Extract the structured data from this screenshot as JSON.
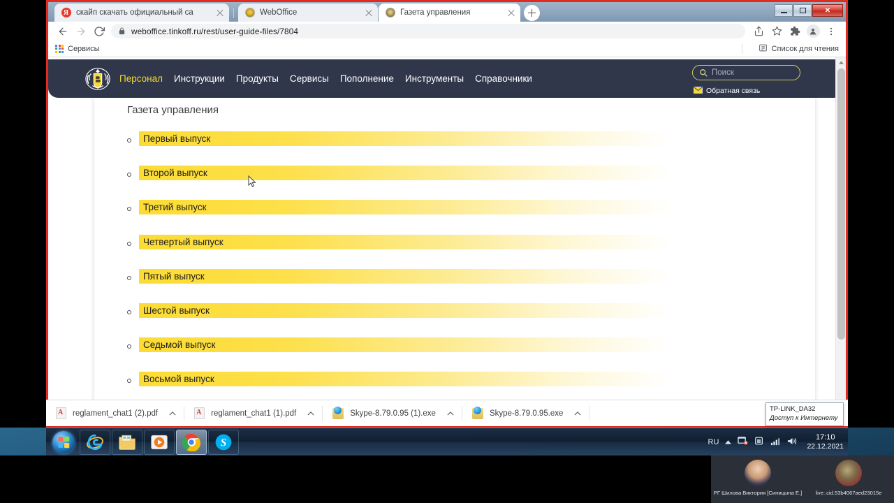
{
  "browser": {
    "tabs": [
      {
        "title": "скайп скачать официальный са",
        "favicon": "yandex-icon",
        "active": false
      },
      {
        "title": "WebOffice",
        "favicon": "crest-icon",
        "active": false
      },
      {
        "title": "Газета управления",
        "favicon": "crest-icon",
        "active": true
      }
    ],
    "new_tab_label": "+",
    "window_controls": {
      "minimize": "minimize-icon",
      "maximize": "maximize-icon",
      "close": "✕"
    },
    "toolbar": {
      "back": "back-arrow-icon",
      "forward": "forward-arrow-icon",
      "reload": "reload-icon",
      "lock": "lock-icon",
      "url": "weboffice.tinkoff.ru/rest/user-guide-files/7804",
      "share": "share-icon",
      "bookmark": "star-icon",
      "extensions": "puzzle-icon",
      "profile": "avatar-icon",
      "menu": "three-dot-menu-icon"
    },
    "bookmarks": {
      "apps_label": "Сервисы",
      "reading_list_label": "Список для чтения"
    }
  },
  "site": {
    "nav": {
      "logo": "tinkoff-crest-icon",
      "links": [
        {
          "label": "Персонал",
          "active": true
        },
        {
          "label": "Инструкции",
          "active": false
        },
        {
          "label": "Продукты",
          "active": false
        },
        {
          "label": "Сервисы",
          "active": false
        },
        {
          "label": "Пополнение",
          "active": false
        },
        {
          "label": "Инструменты",
          "active": false
        },
        {
          "label": "Справочники",
          "active": false
        }
      ],
      "search_placeholder": "Поиск",
      "feedback_label": "Обратная связь",
      "accent_color": "#f3d832",
      "bar_color": "#30374b"
    },
    "page_title": "Газета управления",
    "issues": [
      {
        "label": "Первый выпуск"
      },
      {
        "label": "Второй выпуск"
      },
      {
        "label": "Третий выпуск"
      },
      {
        "label": "Четвертый выпуск"
      },
      {
        "label": "Пятый выпуск"
      },
      {
        "label": "Шестой выпуск"
      },
      {
        "label": "Седьмой выпуск"
      },
      {
        "label": "Восьмой выпуск"
      }
    ],
    "highlight_color": "#fcdc33"
  },
  "downloads": [
    {
      "name": "reglament_chat1 (2).pdf",
      "type": "pdf"
    },
    {
      "name": "reglament_chat1 (1).pdf",
      "type": "pdf"
    },
    {
      "name": "Skype-8.79.0.95 (1).exe",
      "type": "exe"
    },
    {
      "name": "Skype-8.79.0.95.exe",
      "type": "exe"
    }
  ],
  "tray_tooltip": {
    "network_name": "TP-LINK_DA32",
    "status": "Доступ к Интернету"
  },
  "taskbar": {
    "start": "windows-start-icon",
    "apps": [
      {
        "name": "internet-explorer-icon",
        "active": false
      },
      {
        "name": "file-explorer-icon",
        "active": false
      },
      {
        "name": "media-player-icon",
        "active": false
      },
      {
        "name": "google-chrome-icon",
        "active": true
      },
      {
        "name": "skype-icon",
        "active": false
      }
    ],
    "language": "RU",
    "time": "17:10",
    "date": "22.12.2021"
  },
  "video_call": {
    "participants": [
      {
        "name": "РГ Шилова Виктория [Синицына Е.]"
      },
      {
        "name": "live:.cid.53b4067aed23015e"
      }
    ]
  }
}
